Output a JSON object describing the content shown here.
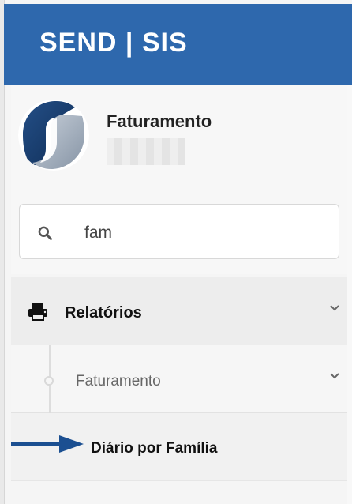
{
  "header": {
    "brand": "SEND | SIS"
  },
  "profile": {
    "name": "Faturamento"
  },
  "search": {
    "value": "fam"
  },
  "menu": {
    "reports_label": "Relatórios",
    "sub_label": "Faturamento",
    "leaf_label": "Diário por Família"
  },
  "colors": {
    "header": "#2e68ad",
    "arrow": "#1b4f91"
  },
  "icons": {
    "search": "search-icon",
    "printer": "printer-icon",
    "chevron": "chevron-down-icon",
    "pointer": "arrow-right-icon"
  }
}
